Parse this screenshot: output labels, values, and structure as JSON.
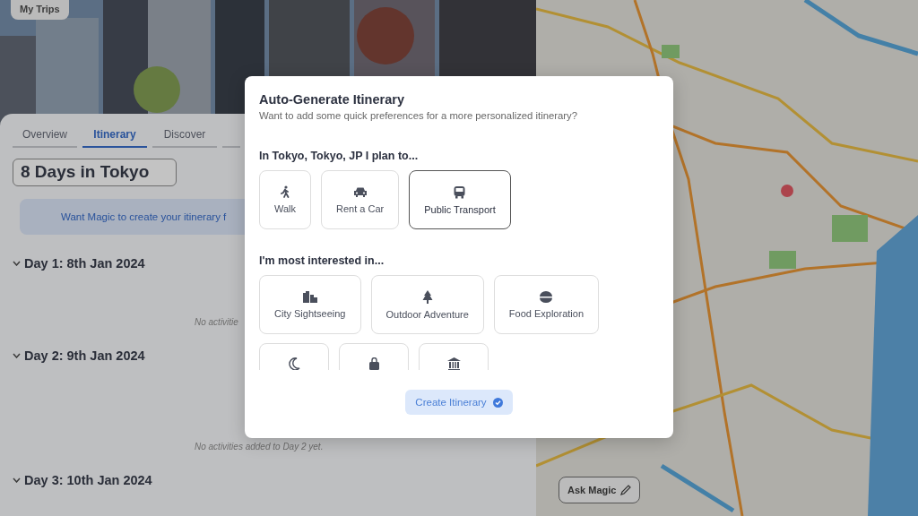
{
  "header": {
    "my_trips_button": "My Trips"
  },
  "tabs": [
    {
      "label": "Overview",
      "selected": false
    },
    {
      "label": "Itinerary",
      "selected": true
    },
    {
      "label": "Discover",
      "selected": false
    }
  ],
  "trip_title": "8 Days in Tokyo",
  "magic_banner": "Want Magic to create your itinerary f",
  "days": [
    {
      "title": "Day 1: 8th Jan 2024",
      "expanded": true,
      "empty_note": "No activitie"
    },
    {
      "title": "Day 2: 9th Jan 2024",
      "expanded": true,
      "empty_note": "No activities added to Day 2 yet."
    },
    {
      "title": "Day 3: 10th Jan 2024",
      "expanded": true
    }
  ],
  "ask_magic_button": "Ask Magic",
  "modal": {
    "title": "Auto-Generate Itinerary",
    "subtitle": "Want to add some quick preferences for a more personalized itinerary?",
    "transport_heading": "In Tokyo, Tokyo, JP I plan to...",
    "transport_options": [
      {
        "label": "Walk",
        "kind": "walk",
        "selected": false
      },
      {
        "label": "Rent a Car",
        "kind": "car",
        "selected": false
      },
      {
        "label": "Public Transport",
        "kind": "bus",
        "selected": true
      }
    ],
    "interests_heading": "I'm most interested in...",
    "interests": [
      {
        "label": "City Sightseeing",
        "kind": "city",
        "selected": false
      },
      {
        "label": "Outdoor Adventure",
        "kind": "tree",
        "selected": false
      },
      {
        "label": "Food Exploration",
        "kind": "bowl",
        "selected": false
      },
      {
        "kind": "moon",
        "selected": false
      },
      {
        "kind": "bag",
        "selected": false
      },
      {
        "kind": "museum",
        "selected": false
      }
    ],
    "create_button": "Create Itinerary"
  }
}
